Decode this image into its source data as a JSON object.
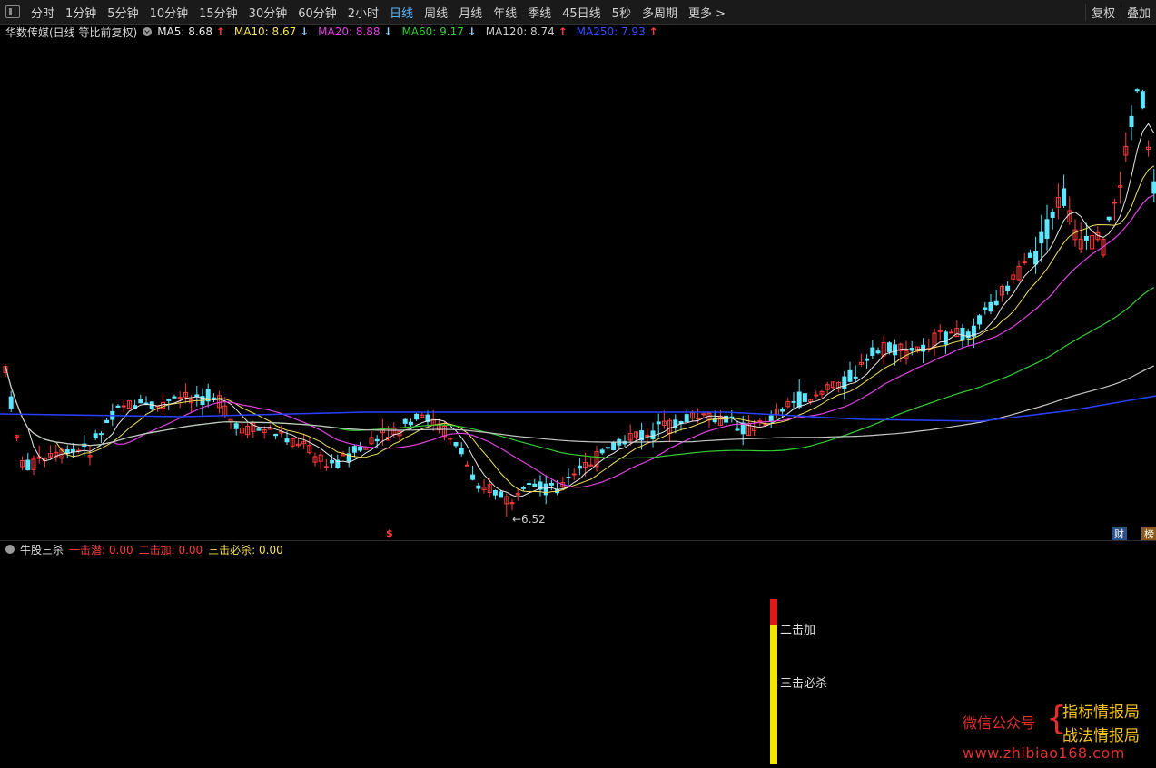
{
  "toolbar": {
    "periods": [
      "分时",
      "1分钟",
      "5分钟",
      "10分钟",
      "15分钟",
      "30分钟",
      "60分钟",
      "2小时",
      "日线",
      "周线",
      "月线",
      "年线",
      "季线",
      "45日线",
      "5秒",
      "多周期",
      "更多 >"
    ],
    "active_period": "日线",
    "right_buttons": [
      "复权",
      "叠加"
    ]
  },
  "header": {
    "title": "华数传媒(日线 等比前复权)",
    "ma": [
      {
        "label": "MA5: 8.68",
        "arrow": "↑",
        "color": "#e8e8e8"
      },
      {
        "label": "MA10: 8.67",
        "arrow": "↓",
        "color": "#f2e05a"
      },
      {
        "label": "MA20: 8.88",
        "arrow": "↓",
        "color": "#e040e0"
      },
      {
        "label": "MA60: 9.17",
        "arrow": "↓",
        "color": "#33cc33"
      },
      {
        "label": "MA120: 8.74",
        "arrow": "↑",
        "color": "#c8c8c8"
      },
      {
        "label": "MA250: 7.93",
        "arrow": "↑",
        "color": "#3a50ff"
      }
    ]
  },
  "chart": {
    "low_marker": "←6.52",
    "s_marker": "$",
    "badge_cai": "财",
    "badge_bang": "榜"
  },
  "indicator": {
    "name": "牛股三杀",
    "items": [
      {
        "label": "一击潜: 0.00",
        "color": "#ff3b3b"
      },
      {
        "label": "二击加: 0.00",
        "color": "#ff3b3b"
      },
      {
        "label": "三击必杀: 0.00",
        "color": "#f2e05a"
      }
    ],
    "bar_label_top": "二击加",
    "bar_label_bottom": "三击必杀"
  },
  "watermark": {
    "left": "微信公众号",
    "right1": "指标情报局",
    "right2": "战法情报局",
    "url": "www.zhibiao168.com"
  }
}
